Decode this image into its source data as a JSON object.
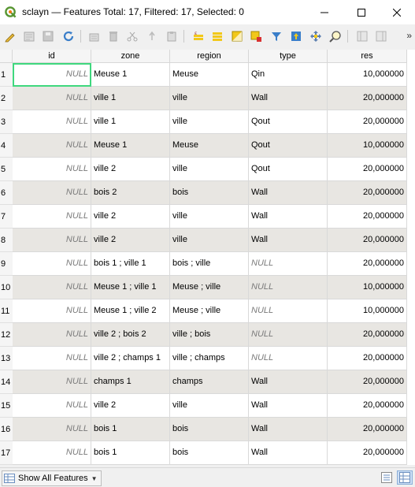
{
  "window": {
    "title": "sclayn — Features Total: 17, Filtered: 17, Selected: 0"
  },
  "toolbar": {
    "icons": [
      "pencil-icon",
      "toggle-multi-edit-icon",
      "save-edits-icon",
      "reload-icon",
      "add-feature-icon",
      "delete-feature-icon",
      "cut-icon",
      "copy-icon",
      "paste-icon",
      "select-by-expression-icon",
      "select-all-icon",
      "invert-selection-icon",
      "deselect-all-icon",
      "filter-icon",
      "move-selection-to-top-icon",
      "pan-to-selected-icon",
      "zoom-to-selected-icon",
      "new-field-icon",
      "delete-field-icon"
    ],
    "overflow": "»"
  },
  "table": {
    "columns": [
      "id",
      "zone",
      "region",
      "type",
      "res"
    ],
    "rows": [
      {
        "n": "1",
        "id": "NULL",
        "zone": "Meuse 1",
        "region": "Meuse",
        "type": "Qin",
        "res": "10,000000"
      },
      {
        "n": "2",
        "id": "NULL",
        "zone": "ville 1",
        "region": "ville",
        "type": "Wall",
        "res": "20,000000"
      },
      {
        "n": "3",
        "id": "NULL",
        "zone": "ville 1",
        "region": "ville",
        "type": "Qout",
        "res": "20,000000"
      },
      {
        "n": "4",
        "id": "NULL",
        "zone": "Meuse 1",
        "region": "Meuse",
        "type": "Qout",
        "res": "10,000000"
      },
      {
        "n": "5",
        "id": "NULL",
        "zone": "ville 2",
        "region": "ville",
        "type": "Qout",
        "res": "20,000000"
      },
      {
        "n": "6",
        "id": "NULL",
        "zone": "bois 2",
        "region": "bois",
        "type": "Wall",
        "res": "20,000000"
      },
      {
        "n": "7",
        "id": "NULL",
        "zone": "ville 2",
        "region": "ville",
        "type": "Wall",
        "res": "20,000000"
      },
      {
        "n": "8",
        "id": "NULL",
        "zone": "ville 2",
        "region": "ville",
        "type": "Wall",
        "res": "20,000000"
      },
      {
        "n": "9",
        "id": "NULL",
        "zone": "bois 1 ; ville 1",
        "region": "bois ; ville",
        "type": "NULL",
        "res": "20,000000"
      },
      {
        "n": "10",
        "id": "NULL",
        "zone": "Meuse 1 ; ville 1",
        "region": "Meuse ; ville",
        "type": "NULL",
        "res": "10,000000"
      },
      {
        "n": "11",
        "id": "NULL",
        "zone": "Meuse 1 ; ville 2",
        "region": "Meuse ; ville",
        "type": "NULL",
        "res": "10,000000"
      },
      {
        "n": "12",
        "id": "NULL",
        "zone": "ville 2 ; bois 2",
        "region": "ville ; bois",
        "type": "NULL",
        "res": "20,000000"
      },
      {
        "n": "13",
        "id": "NULL",
        "zone": "ville 2 ; champs 1",
        "region": "ville ; champs",
        "type": "NULL",
        "res": "20,000000"
      },
      {
        "n": "14",
        "id": "NULL",
        "zone": "champs 1",
        "region": "champs",
        "type": "Wall",
        "res": "20,000000"
      },
      {
        "n": "15",
        "id": "NULL",
        "zone": "ville 2",
        "region": "ville",
        "type": "Wall",
        "res": "20,000000"
      },
      {
        "n": "16",
        "id": "NULL",
        "zone": "bois 1",
        "region": "bois",
        "type": "Wall",
        "res": "20,000000"
      },
      {
        "n": "17",
        "id": "NULL",
        "zone": "bois 1",
        "region": "bois",
        "type": "Wall",
        "res": "20,000000"
      }
    ]
  },
  "status": {
    "filter_label": "Show All Features",
    "view_icons": [
      "form-view-icon",
      "table-view-icon"
    ]
  }
}
